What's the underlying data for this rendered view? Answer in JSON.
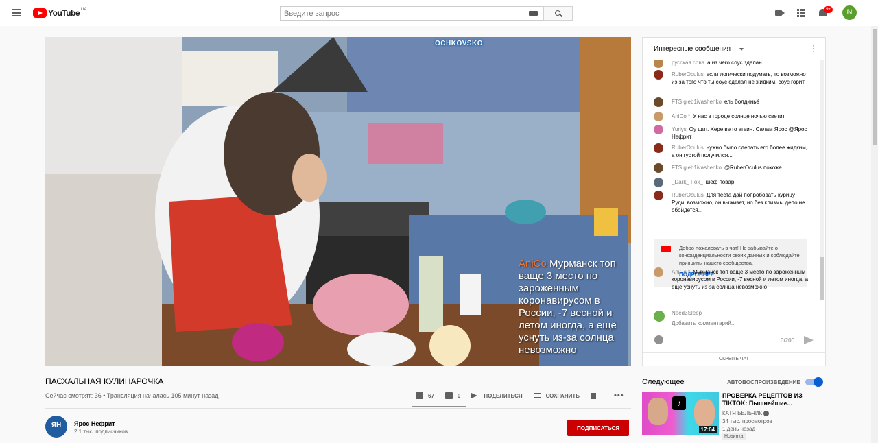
{
  "header": {
    "logo_text": "YouTube",
    "region": "UA",
    "search_placeholder": "Введите запрос",
    "notifications_badge": "9+",
    "avatar_letter": "N"
  },
  "player": {
    "overlay_channel": "OCHKOVSKO",
    "overlay_author": "AniCo ",
    "overlay_text": " Мурманск топ ваще 3 место по зароженным коронавирусом в России, -7 весной и летом иногда, а ещё уснуть из-за солнца невозможно"
  },
  "video": {
    "title": "ПАСХАЛЬНАЯ КУЛИНАРОЧКА",
    "meta": "Сейчас смотрят: 36 • Трансляция началась 105 минут назад",
    "likes": "67",
    "dislikes": "0",
    "share_label": "ПОДЕЛИТЬСЯ",
    "save_label": "СОХРАНИТЬ",
    "channel_name": "Ярос Нефрит",
    "subscribers": "2,1 тыс. подписчиков",
    "subscribe_label": "ПОДПИСАТЬСЯ"
  },
  "chat": {
    "title": "Интересные сообщения",
    "messages": [
      {
        "author": "русская сова",
        "text": "а из чего соус зделан",
        "color": "#b8864b"
      },
      {
        "author": "RuberOculus",
        "text": "если логически подумать, то возможно из-за того что ты соус сделал не жидким, соус горит",
        "color": "#8a2a1a"
      },
      {
        "author": "FTS gleb1ivashenko",
        "text": "ель болдиньё",
        "color": "#6a4a2a"
      },
      {
        "author": "AniCo *",
        "text": "У нас в городе солнце ночью светит",
        "color": "#c89a6a"
      },
      {
        "author": "Yuriys",
        "text": "Оу щит. Хере ве го агеин. Салам Ярос @Ярос Нефрит",
        "color": "#d06aa0"
      },
      {
        "author": "RuberOculus",
        "text": "нужно было сделать его более жидким, а он густой получился...",
        "color": "#8a2a1a"
      },
      {
        "author": "FTS gleb1ivashenko",
        "text": "@RuberOculus похоже",
        "color": "#6a4a2a"
      },
      {
        "author": "_Dark_ Fox_",
        "text": "шеф повар",
        "color": "#5a6a7a"
      },
      {
        "author": "RuberOculus",
        "text": "Для теста дай попробовать курицу Руди, возможно, он выживет, но без клизмы дело не обойдется...",
        "color": "#8a2a1a"
      },
      {
        "author": "AniCo *",
        "text": "Мурманск топ ваще 3 место по зароженным коронавирусом в России, -7 весной и летом иногда, а ещё уснуть из-за солнца невозможно",
        "color": "#c89a6a"
      }
    ],
    "welcome_text": "Добро пожаловать в чат! Не забывайте о конфиденциальности своих данных и соблюдайте принципы нашего сообщества.",
    "welcome_more": "ПОДРОБНЕЕ",
    "input_user": "Need3Sleep",
    "input_placeholder": "Добавить комментарий...",
    "char_count": "0/200",
    "hide_label": "СКРЫТЬ ЧАТ"
  },
  "sidebar": {
    "next_label": "Следующее",
    "autoplay_label": "АВТОВОСПРОИЗВЕДЕНИЕ",
    "autoplay_on": true,
    "rec": {
      "title": "ПРОВЕРКА РЕЦЕПТОВ ИЗ TIKTOK: Пышнейшие...",
      "channel": "КАТЯ БЕЛЬЧИК",
      "views": "34 тыс. просмотров",
      "ago": "1 день назад",
      "badge": "Новинка",
      "duration": "17:04"
    }
  }
}
